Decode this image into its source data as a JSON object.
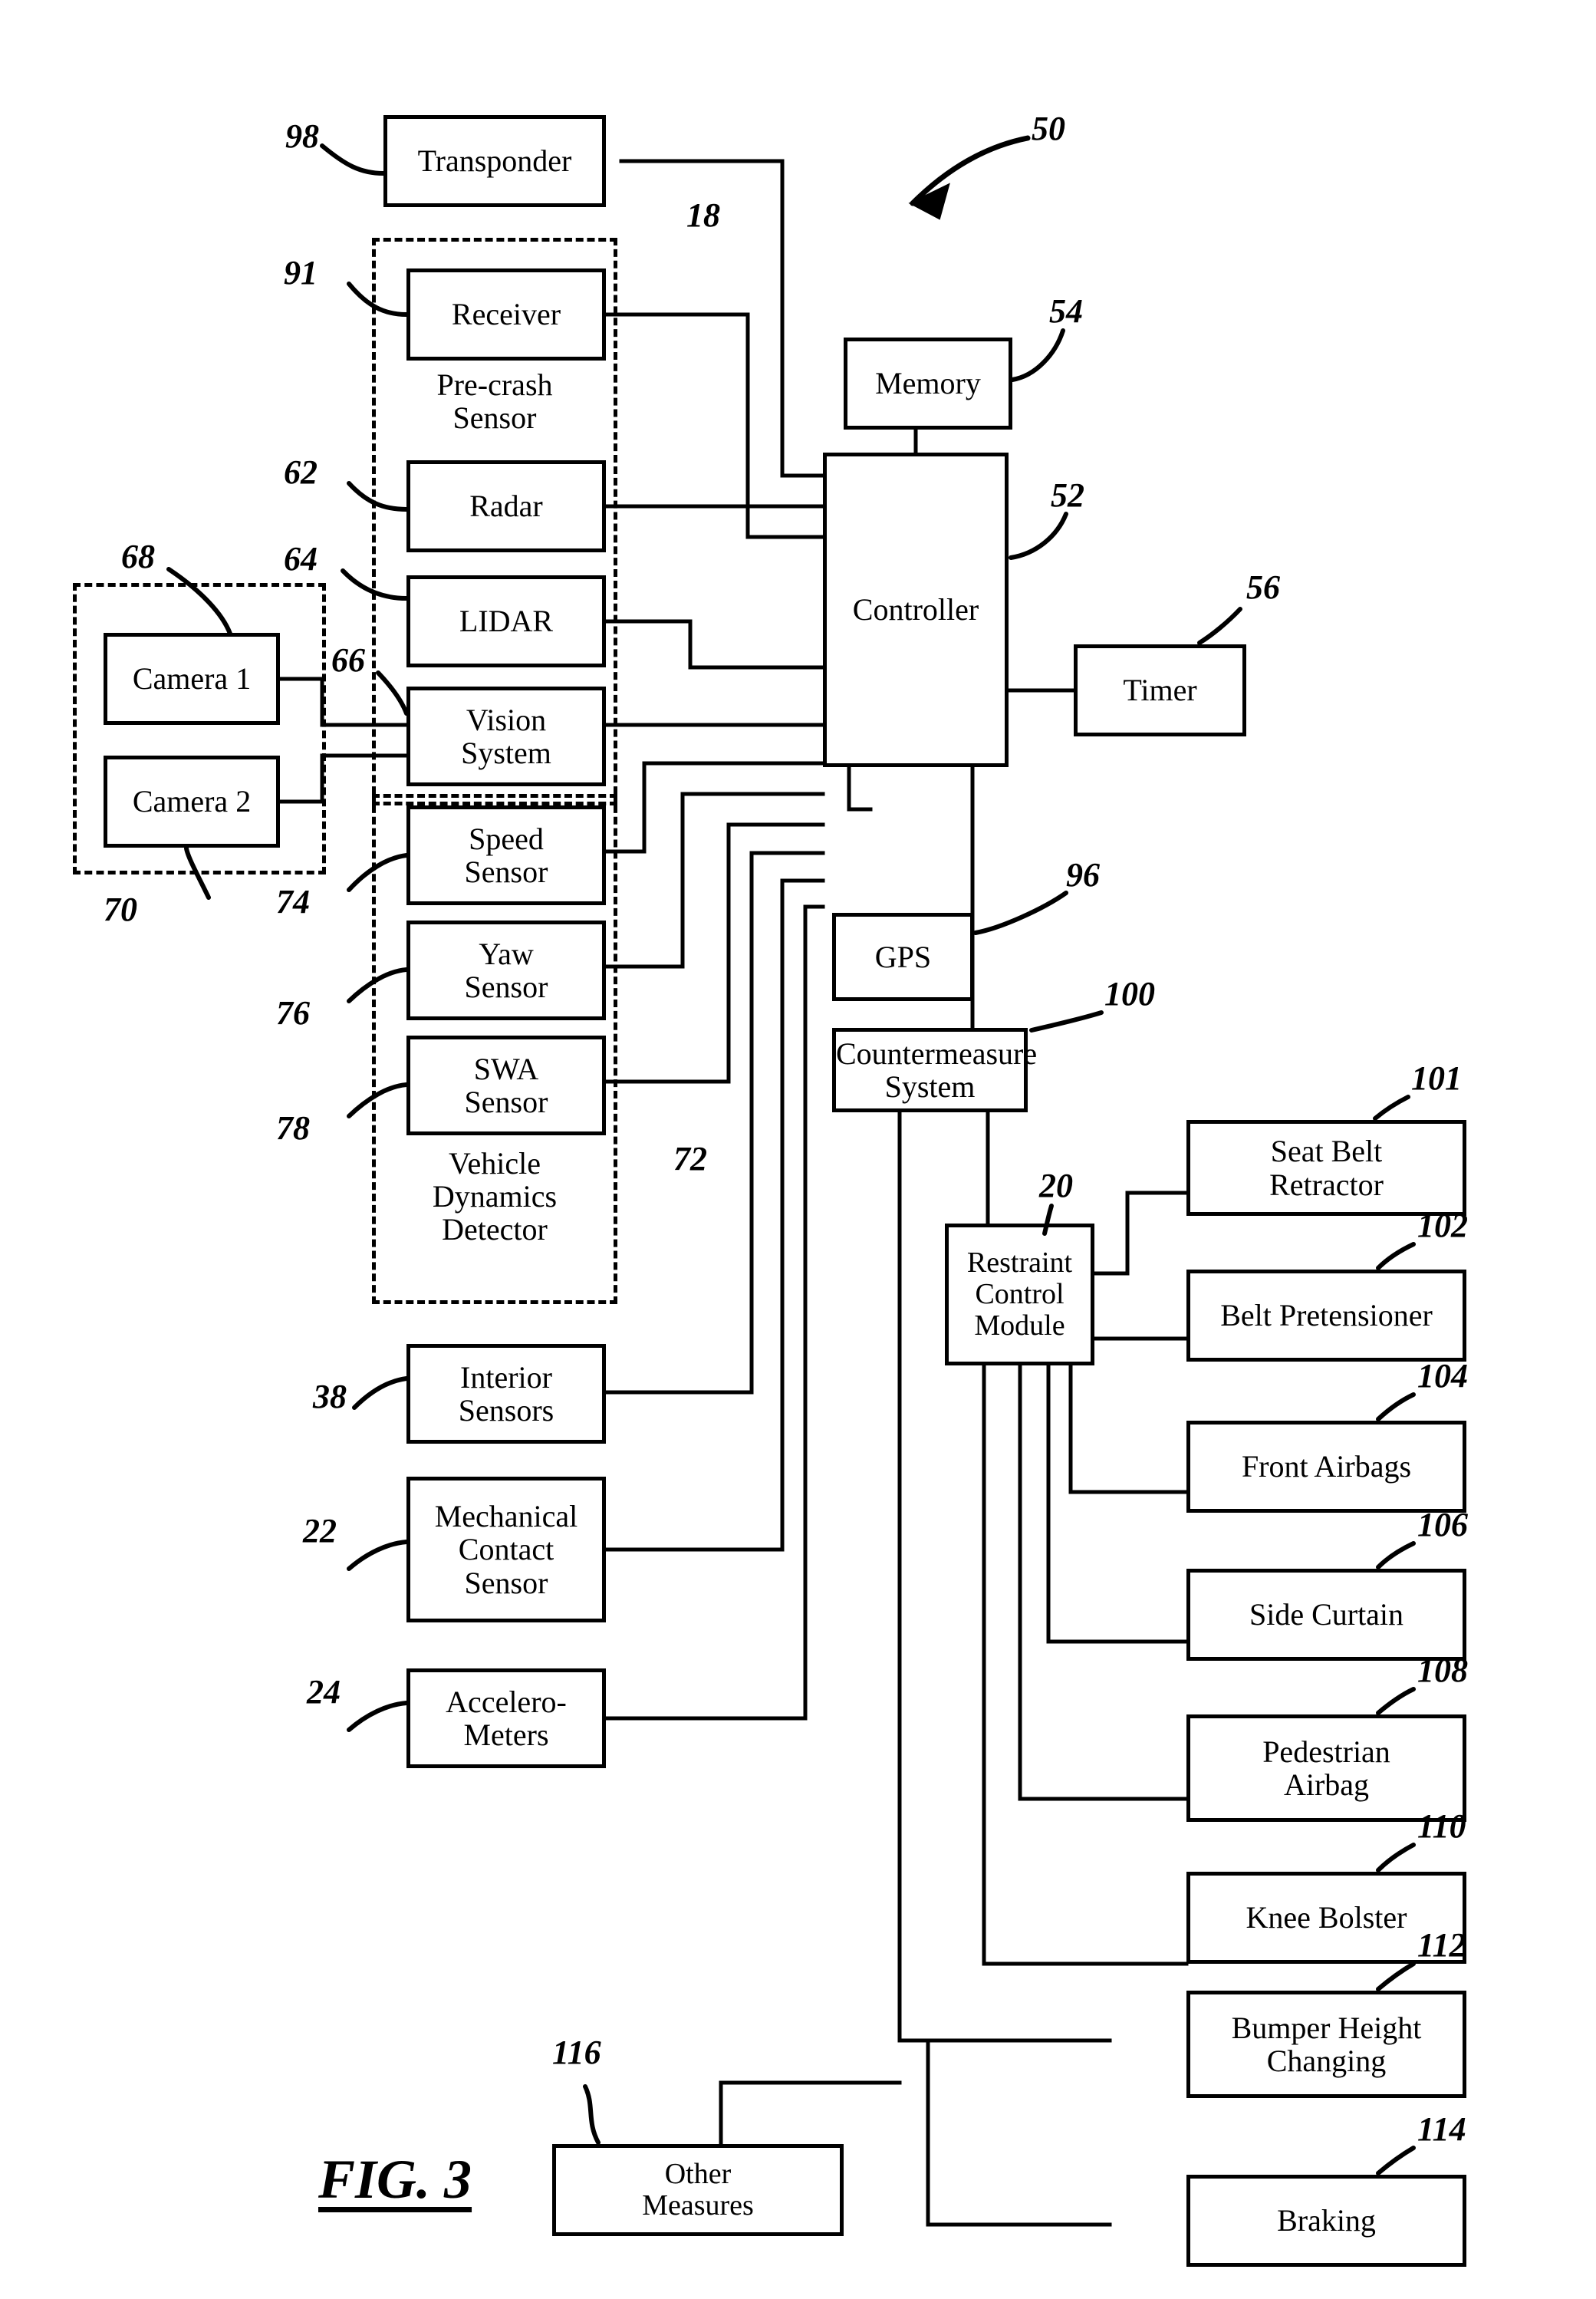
{
  "figure": {
    "label": "FIG. 3",
    "system_ref": "50"
  },
  "blocks": {
    "transponder": {
      "label": "Transponder",
      "ref": "98"
    },
    "receiver": {
      "label": "Receiver",
      "ref": "91"
    },
    "radar": {
      "label": "Radar",
      "ref": "62"
    },
    "lidar": {
      "label": "LIDAR",
      "ref": "64"
    },
    "vision_system": {
      "label": "Vision\nSystem",
      "ref": "66"
    },
    "camera1": {
      "label": "Camera 1",
      "ref": "68"
    },
    "camera2": {
      "label": "Camera 2",
      "ref": "70"
    },
    "speed_sensor": {
      "label": "Speed\nSensor",
      "ref": "74"
    },
    "yaw_sensor": {
      "label": "Yaw\nSensor",
      "ref": "76"
    },
    "swa_sensor": {
      "label": "SWA\nSensor",
      "ref": "78"
    },
    "interior_sensors": {
      "label": "Interior\nSensors",
      "ref": "38"
    },
    "mechanical_contact": {
      "label": "Mechanical\nContact\nSensor",
      "ref": "22"
    },
    "accelerometers": {
      "label": "Accelero-\nMeters",
      "ref": "24"
    },
    "memory": {
      "label": "Memory",
      "ref": "54"
    },
    "controller": {
      "label": "Controller",
      "ref": "52"
    },
    "timer": {
      "label": "Timer",
      "ref": "56"
    },
    "gps": {
      "label": "GPS",
      "ref": "96"
    },
    "countermeasure_system": {
      "label": "Countermeasure\nSystem",
      "ref": "100"
    },
    "restraint_control": {
      "label": "Restraint\nControl\nModule",
      "ref": "20"
    },
    "seat_belt_retractor": {
      "label": "Seat Belt\nRetractor",
      "ref": "101"
    },
    "belt_pretensioner": {
      "label": "Belt Pretensioner",
      "ref": "102"
    },
    "front_airbags": {
      "label": "Front Airbags",
      "ref": "104"
    },
    "side_curtain": {
      "label": "Side Curtain",
      "ref": "106"
    },
    "pedestrian_airbag": {
      "label": "Pedestrian\nAirbag",
      "ref": "108"
    },
    "knee_bolster": {
      "label": "Knee Bolster",
      "ref": "110"
    },
    "bumper_height": {
      "label": "Bumper Height\nChanging",
      "ref": "112"
    },
    "braking": {
      "label": "Braking",
      "ref": "114"
    },
    "other_measures": {
      "label": "Other\nMeasures",
      "ref": "116"
    }
  },
  "groups": {
    "pre_crash_sensor": {
      "label": "Pre-crash\nSensor",
      "ref": "18"
    },
    "vehicle_dynamics_detector": {
      "label": "Vehicle\nDynamics\nDetector",
      "ref": "72"
    },
    "camera_group": {
      "label": "",
      "ref": ""
    }
  },
  "colors": {
    "line": "#000000",
    "background": "#ffffff"
  }
}
